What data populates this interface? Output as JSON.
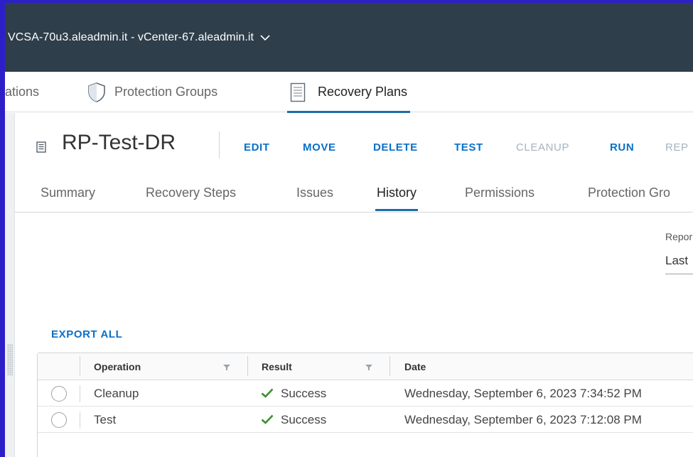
{
  "header": {
    "vcenter_title": "VCSA-70u3.aleadmin.it - vCenter-67.aleadmin.it"
  },
  "main_tabs": [
    {
      "label": "ations",
      "icon": null
    },
    {
      "label": "Protection Groups",
      "icon": "shield-icon"
    },
    {
      "label": "Recovery Plans",
      "icon": "document-list-icon",
      "active": true
    }
  ],
  "object": {
    "title": "RP-Test-DR",
    "icon": "recovery-plan-icon",
    "actions": [
      {
        "label": "EDIT",
        "enabled": true
      },
      {
        "label": "MOVE",
        "enabled": true
      },
      {
        "label": "DELETE",
        "enabled": true
      },
      {
        "label": "TEST",
        "enabled": true
      },
      {
        "label": "CLEANUP",
        "enabled": false
      },
      {
        "label": "RUN",
        "enabled": true
      },
      {
        "label": "REP",
        "enabled": false
      }
    ]
  },
  "sub_tabs": [
    {
      "label": "Summary"
    },
    {
      "label": "Recovery Steps"
    },
    {
      "label": "Issues"
    },
    {
      "label": "History",
      "active": true
    },
    {
      "label": "Permissions"
    },
    {
      "label": "Protection Gro"
    }
  ],
  "report": {
    "label": "Repor",
    "value": "Last"
  },
  "export_all_label": "EXPORT ALL",
  "table": {
    "columns": [
      {
        "label": "Operation",
        "filterable": true
      },
      {
        "label": "Result",
        "filterable": true
      },
      {
        "label": "Date",
        "filterable": false
      }
    ],
    "rows": [
      {
        "operation": "Cleanup",
        "result": "Success",
        "date": "Wednesday, September 6, 2023 7:34:52 PM"
      },
      {
        "operation": "Test",
        "result": "Success",
        "date": "Wednesday, September 6, 2023 7:12:08 PM"
      }
    ]
  },
  "colors": {
    "topbar": "#2e3e4a",
    "accent_link": "#0a70c7",
    "active_tab_underline": "#1d6ea5",
    "success_green": "#3c8e2e",
    "window_border": "#2d1fc8"
  }
}
